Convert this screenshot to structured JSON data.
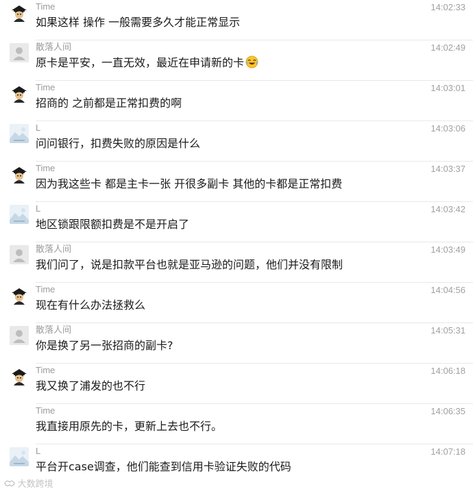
{
  "messages": [
    {
      "sender": "Time",
      "avatar": "time-avatar-icon",
      "time": "14:02:33",
      "text": "如果这样 操作 一般需要多久才能正常显示"
    },
    {
      "sender": "散落人间",
      "avatar": "default-user-avatar-icon",
      "time": "14:02:49",
      "text": "原卡是平安，一直无效，最近在申请新的卡",
      "emoji": "laughing-crying-emoji-icon"
    },
    {
      "sender": "Time",
      "avatar": "time-avatar-icon",
      "time": "14:03:01",
      "text": "招商的 之前都是正常扣费的啊"
    },
    {
      "sender": "L",
      "avatar": "landscape-avatar-icon",
      "time": "14:03:06",
      "text": "问问银行，扣费失败的原因是什么"
    },
    {
      "sender": "Time",
      "avatar": "time-avatar-icon",
      "time": "14:03:37",
      "text": "因为我这些卡 都是主卡一张 开很多副卡 其他的卡都是正常扣费"
    },
    {
      "sender": "L",
      "avatar": "landscape-avatar-icon",
      "time": "14:03:42",
      "text": "地区锁跟限额扣费是不是开启了"
    },
    {
      "sender": "散落人间",
      "avatar": "default-user-avatar-icon",
      "time": "14:03:49",
      "text": "我们问了，说是扣款平台也就是亚马逊的问题，他们并没有限制"
    },
    {
      "sender": "Time",
      "avatar": "time-avatar-icon",
      "time": "14:04:56",
      "text": "现在有什么办法拯救么"
    },
    {
      "sender": "散落人间",
      "avatar": "default-user-avatar-icon",
      "time": "14:05:31",
      "text": "你是换了另一张招商的副卡?"
    },
    {
      "sender": "Time",
      "avatar": "time-avatar-icon",
      "time": "14:06:18",
      "text": "我又换了浦发的也不行"
    },
    {
      "sender": "Time",
      "avatar": "",
      "time": "14:06:35",
      "text": "我直接用原先的卡，更新上去也不行。"
    },
    {
      "sender": "L",
      "avatar": "landscape-avatar-icon",
      "time": "14:07:18",
      "text": "平台开case调查，他们能查到信用卡验证失败的代码"
    }
  ],
  "watermark": {
    "text": "大数跨境",
    "icon": "watermark-logo-icon"
  }
}
